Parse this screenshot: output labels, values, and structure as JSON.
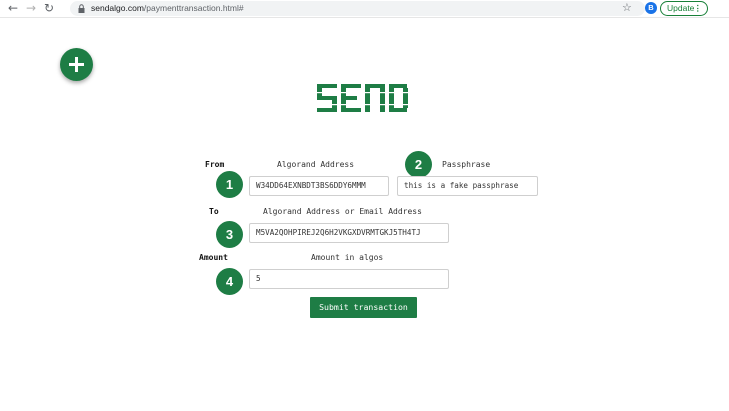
{
  "browser": {
    "url_host": "sendalgo.com",
    "url_path": "/paymenttransaction.html#",
    "avatar_initial": "B",
    "update_label": "Update",
    "menu_dots": "⋮"
  },
  "form": {
    "from_label": "From",
    "from_field_label": "Algorand Address",
    "from_value": "W34DD64EXNBDT3BS6DDY6MMM",
    "passphrase_label": "Passphrase",
    "passphrase_value": "this is a fake passphrase",
    "to_label": "To",
    "to_field_label": "Algorand Address or Email Address",
    "to_value": "M5VA2QOHPIREJ2Q6H2VKGXDVRMTGKJ5TH4TJ",
    "amount_label": "Amount",
    "amount_field_label": "Amount in algos",
    "amount_value": "5",
    "submit_label": "Submit transaction"
  },
  "badges": [
    "1",
    "2",
    "3",
    "4"
  ],
  "colors": {
    "accent": "#1e7d45",
    "update": "#188038",
    "avatar": "#1a73e8"
  },
  "icons": [
    "back-arrow-icon",
    "forward-arrow-icon",
    "reload-icon",
    "lock-icon",
    "star-icon",
    "plus-icon",
    "send-logo"
  ]
}
